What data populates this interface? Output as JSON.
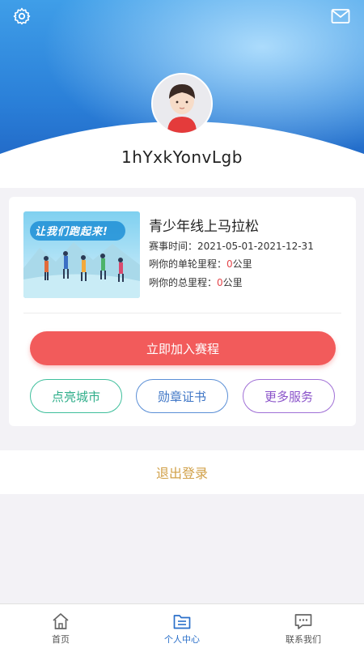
{
  "header": {
    "username": "1hYxkYonvLgb"
  },
  "icons": {
    "settings": "gear-icon",
    "mail": "mail-icon",
    "avatar": "avatar-icon"
  },
  "event": {
    "image_text": "让我们跑起来!",
    "title": "青少年线上马拉松",
    "time_label": "赛事时间：",
    "time_value": "2021-05-01-2021-12-31",
    "single_label": "咧你的单轮里程：",
    "single_value": "0",
    "total_label": "咧你的总里程：",
    "total_value": "0",
    "unit": "公里"
  },
  "actions": {
    "join": "立即加入赛程",
    "city": "点亮城市",
    "medal": "勋章证书",
    "more": "更多服务"
  },
  "logout": "退出登录",
  "tabbar": {
    "home": "首页",
    "center": "个人中心",
    "contact": "联系我们",
    "active": "center"
  },
  "colors": {
    "accent_blue": "#2a6fc9",
    "join_red": "#f25b5b",
    "logout_gold": "#d1a14a",
    "value_red": "#e4464b"
  }
}
